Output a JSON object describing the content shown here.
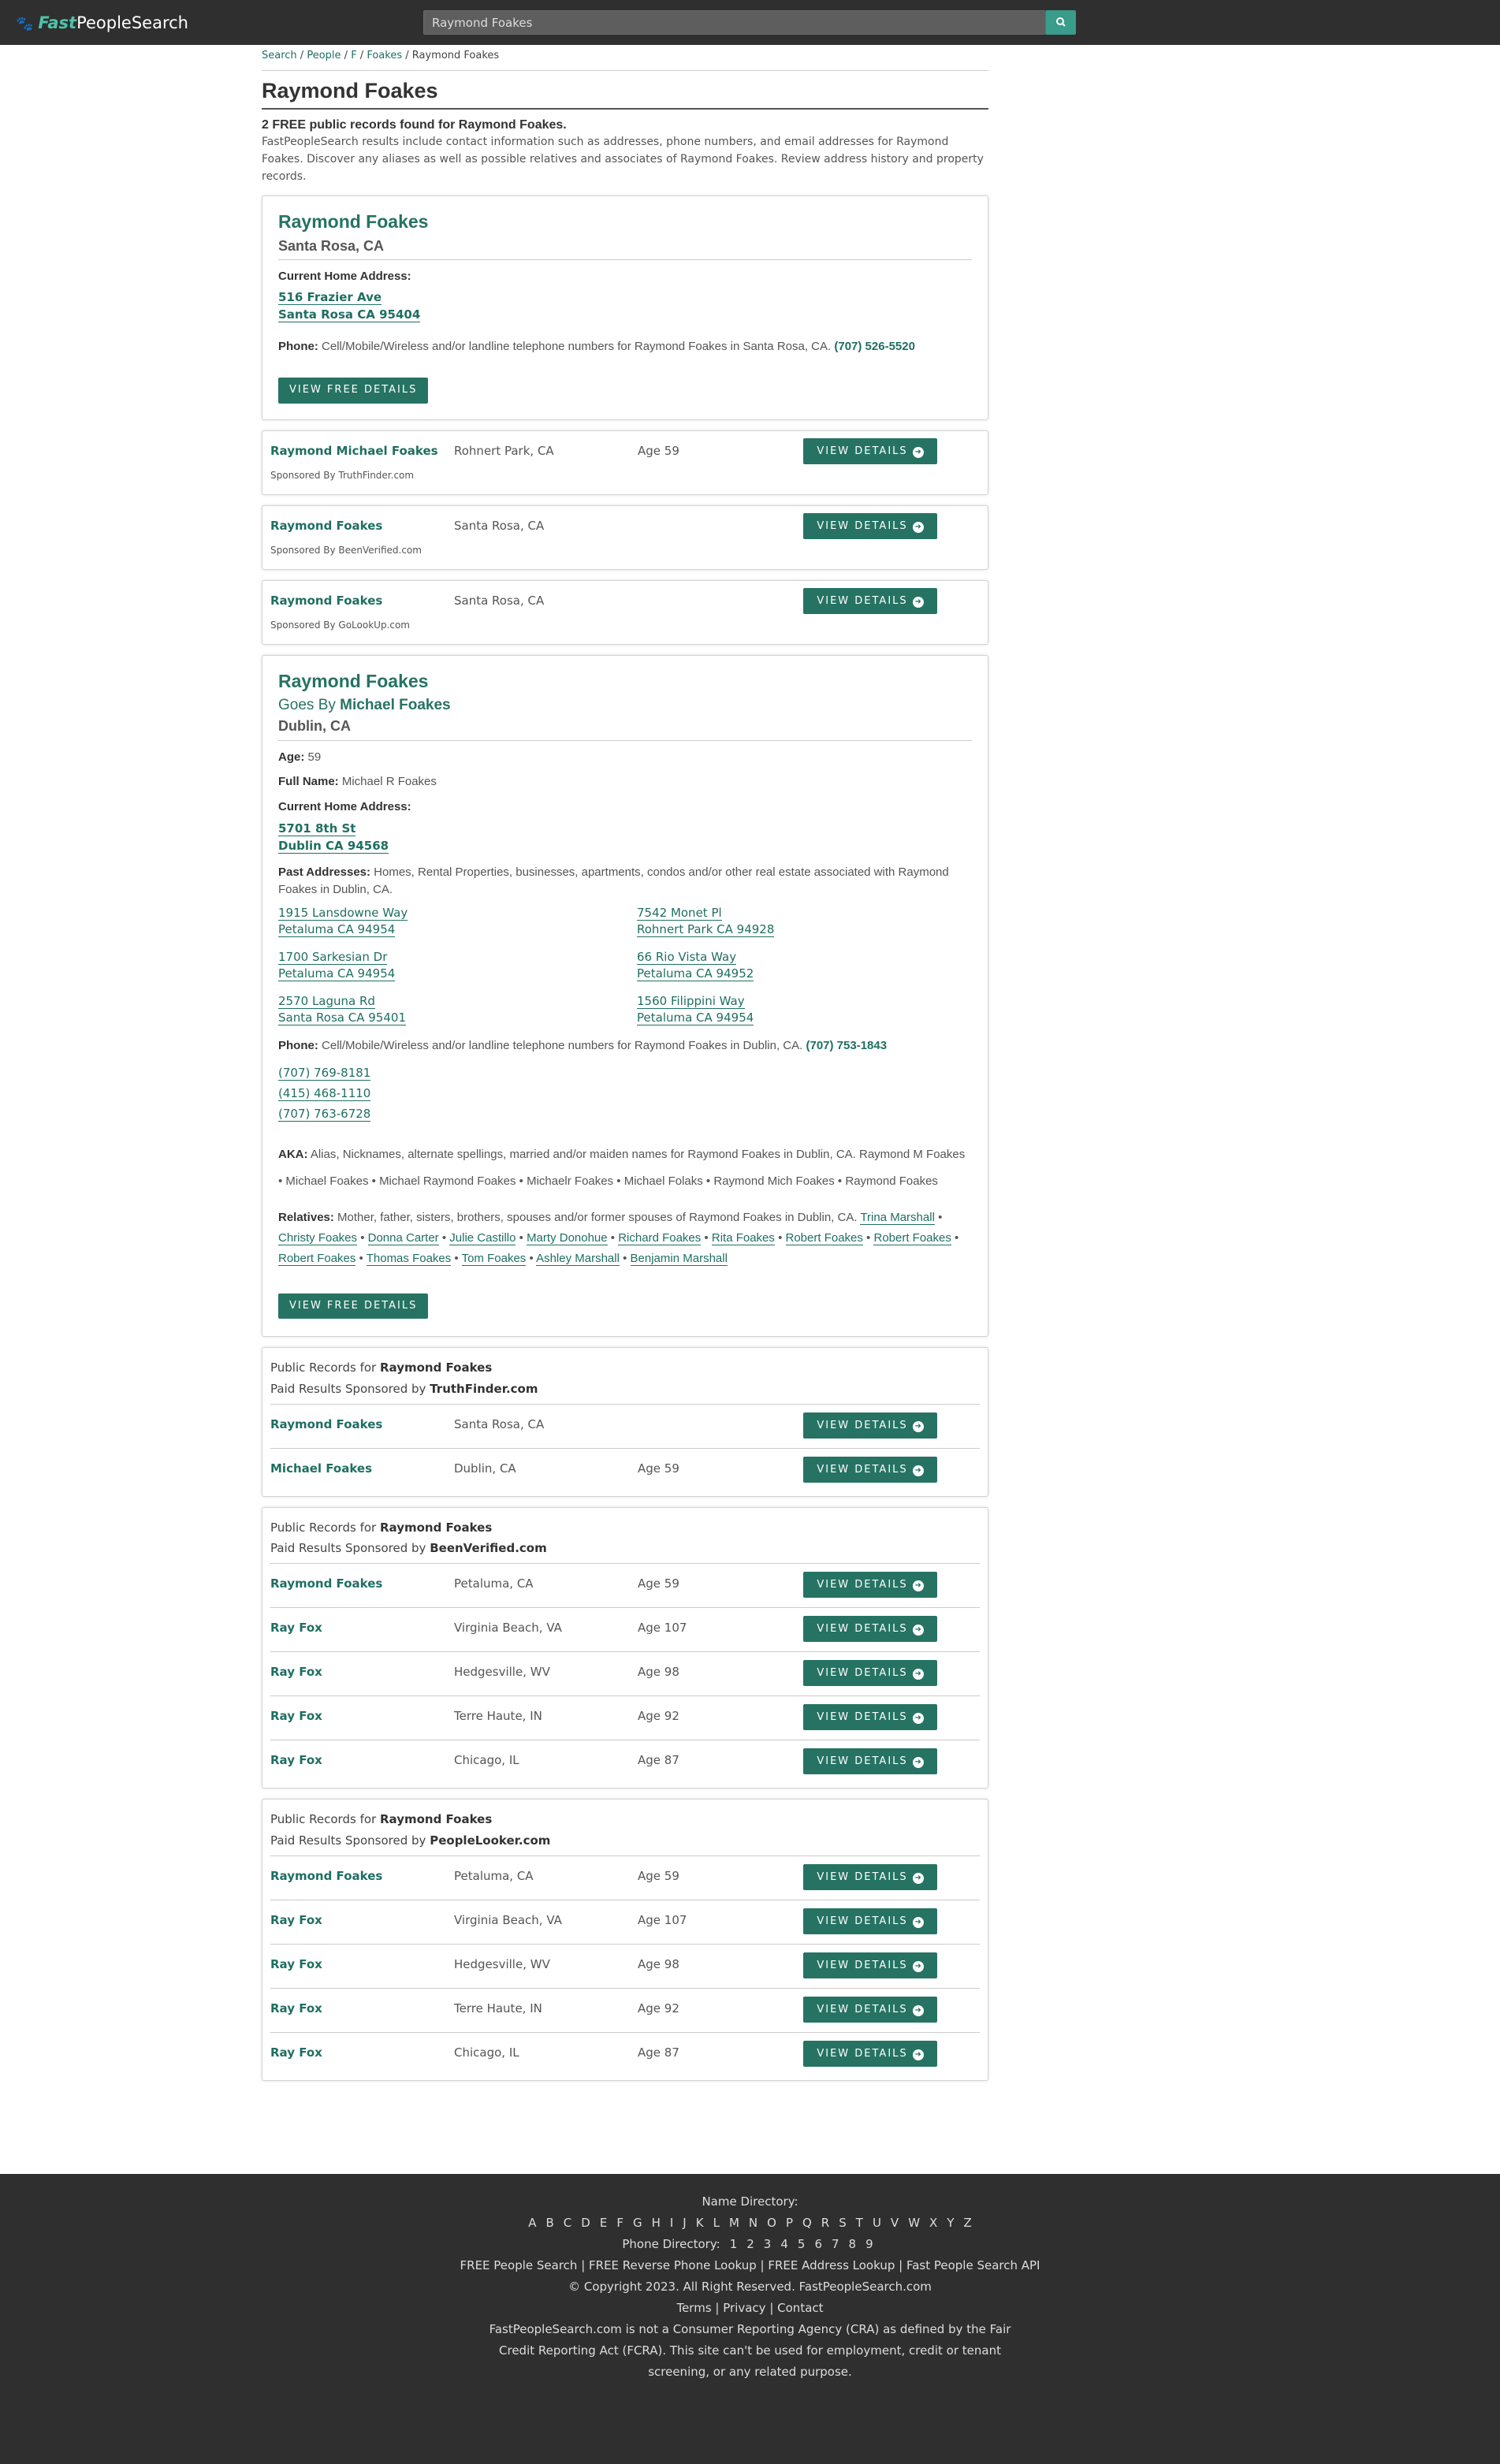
{
  "header": {
    "logo_fast": "Fast",
    "logo_rest": "PeopleSearch",
    "search_value": "Raymond Foakes"
  },
  "breadcrumb": {
    "items": [
      "Search",
      "People",
      "F",
      "Foakes"
    ],
    "current": "Raymond Foakes"
  },
  "page_title": "Raymond Foakes",
  "found_text": "2 FREE public records found for Raymond Foakes.",
  "intro": "FastPeopleSearch results include contact information such as addresses, phone numbers, and email addresses for Raymond Foakes. Discover any aliases as well as possible relatives and associates of Raymond Foakes. Review address history and property records.",
  "record1": {
    "name": "Raymond Foakes",
    "city": "Santa Rosa, CA",
    "addr_label": "Current Home Address:",
    "addr_line1": "516 Frazier Ave",
    "addr_line2": "Santa Rosa CA 95404",
    "phone_label": "Phone:",
    "phone_desc": "Cell/Mobile/Wireless and/or landline telephone numbers for Raymond Foakes in Santa Rosa, CA.",
    "phone": "(707) 526-5520",
    "button": "VIEW FREE DETAILS"
  },
  "sponsored": [
    {
      "name": "Raymond Michael Foakes",
      "loc": "Rohnert Park, CA",
      "age": "Age 59",
      "sponsor": "Sponsored By TruthFinder.com",
      "button": "VIEW DETAILS"
    },
    {
      "name": "Raymond Foakes",
      "loc": "Santa Rosa, CA",
      "age": "",
      "sponsor": "Sponsored By BeenVerified.com",
      "button": "VIEW DETAILS"
    },
    {
      "name": "Raymond Foakes",
      "loc": "Santa Rosa, CA",
      "age": "",
      "sponsor": "Sponsored By GoLookUp.com",
      "button": "VIEW DETAILS"
    }
  ],
  "record2": {
    "name": "Raymond Foakes",
    "goes_by_prefix": "Goes By",
    "goes_by": "Michael Foakes",
    "city": "Dublin, CA",
    "age_label": "Age:",
    "age": "59",
    "fullname_label": "Full Name:",
    "fullname": "Michael R Foakes",
    "addr_label": "Current Home Address:",
    "addr_line1": "5701 8th St",
    "addr_line2": "Dublin CA 94568",
    "past_label": "Past Addresses:",
    "past_desc": "Homes, Rental Properties, businesses, apartments, condos and/or other real estate associated with Raymond Foakes in Dublin, CA.",
    "past": [
      {
        "l1": "1915 Lansdowne Way",
        "l2": "Petaluma CA 94954"
      },
      {
        "l1": "7542 Monet Pl",
        "l2": "Rohnert Park CA 94928"
      },
      {
        "l1": "1700 Sarkesian Dr",
        "l2": "Petaluma CA 94954"
      },
      {
        "l1": "66 Rio Vista Way",
        "l2": "Petaluma CA 94952"
      },
      {
        "l1": "2570 Laguna Rd",
        "l2": "Santa Rosa CA 95401"
      },
      {
        "l1": "1560 Filippini Way",
        "l2": "Petaluma CA 94954"
      }
    ],
    "phone_label": "Phone:",
    "phone_desc": "Cell/Mobile/Wireless and/or landline telephone numbers for Raymond Foakes in Dublin, CA.",
    "phone": "(707) 753-1843",
    "phones": [
      "(707) 769-8181",
      "(415) 468-1110",
      "(707) 763-6728"
    ],
    "aka_label": "AKA:",
    "aka_desc": "Alias, Nicknames, alternate spellings, married and/or maiden names for Raymond Foakes in Dublin, CA.",
    "aka": [
      "Raymond M Foakes",
      "Michael Foakes",
      "Michael Raymond Foakes",
      "Michaelr Foakes",
      "Michael Folaks",
      "Raymond Mich Foakes",
      "Raymond Foakes"
    ],
    "rel_label": "Relatives:",
    "rel_desc": "Mother, father, sisters, brothers, spouses and/or former spouses of Raymond Foakes in Dublin, CA.",
    "relatives": [
      "Trina Marshall",
      "Christy Foakes",
      "Donna Carter",
      "Julie Castillo",
      "Marty Donohue",
      "Richard Foakes",
      "Rita Foakes",
      "Robert Foakes",
      "Robert Foakes",
      "Robert Foakes",
      "Thomas Foakes",
      "Tom Foakes",
      "Ashley Marshall",
      "Benjamin Marshall"
    ],
    "button": "VIEW FREE DETAILS"
  },
  "sections": [
    {
      "head1": "Public Records for",
      "head_name": "Raymond Foakes",
      "head2": "Paid Results Sponsored by",
      "sponsor": "TruthFinder.com",
      "rows": [
        {
          "name": "Raymond Foakes",
          "loc": "Santa Rosa, CA",
          "age": ""
        },
        {
          "name": "Michael Foakes",
          "loc": "Dublin, CA",
          "age": "Age 59"
        }
      ]
    },
    {
      "head1": "Public Records for",
      "head_name": "Raymond Foakes",
      "head2": "Paid Results Sponsored by",
      "sponsor": "BeenVerified.com",
      "rows": [
        {
          "name": "Raymond Foakes",
          "loc": "Petaluma, CA",
          "age": "Age 59"
        },
        {
          "name": "Ray Fox",
          "loc": "Virginia Beach, VA",
          "age": "Age 107"
        },
        {
          "name": "Ray Fox",
          "loc": "Hedgesville, WV",
          "age": "Age 98"
        },
        {
          "name": "Ray Fox",
          "loc": "Terre Haute, IN",
          "age": "Age 92"
        },
        {
          "name": "Ray Fox",
          "loc": "Chicago, IL",
          "age": "Age 87"
        }
      ]
    },
    {
      "head1": "Public Records for",
      "head_name": "Raymond Foakes",
      "head2": "Paid Results Sponsored by",
      "sponsor": "PeopleLooker.com",
      "rows": [
        {
          "name": "Raymond Foakes",
          "loc": "Petaluma, CA",
          "age": "Age 59"
        },
        {
          "name": "Ray Fox",
          "loc": "Virginia Beach, VA",
          "age": "Age 107"
        },
        {
          "name": "Ray Fox",
          "loc": "Hedgesville, WV",
          "age": "Age 98"
        },
        {
          "name": "Ray Fox",
          "loc": "Terre Haute, IN",
          "age": "Age 92"
        },
        {
          "name": "Ray Fox",
          "loc": "Chicago, IL",
          "age": "Age 87"
        }
      ]
    }
  ],
  "view_details": "VIEW DETAILS",
  "footer": {
    "name_dir_label": "Name Directory:",
    "letters": [
      "A",
      "B",
      "C",
      "D",
      "E",
      "F",
      "G",
      "H",
      "I",
      "J",
      "K",
      "L",
      "M",
      "N",
      "O",
      "P",
      "Q",
      "R",
      "S",
      "T",
      "U",
      "V",
      "W",
      "X",
      "Y",
      "Z"
    ],
    "phone_dir_label": "Phone Directory:",
    "digits": [
      "1",
      "2",
      "3",
      "4",
      "5",
      "6",
      "7",
      "8",
      "9"
    ],
    "links_line": "FREE People Search | FREE Reverse Phone Lookup | FREE Address Lookup | Fast People Search API",
    "copyright": "© Copyright 2023. All Right Reserved. FastPeopleSearch.com",
    "terms": "Terms",
    "privacy": "Privacy",
    "contact": "Contact",
    "disclaimer_a": "FastPeopleSearch.com is not a Consumer Reporting Agency (CRA) as defined by the",
    "fcra": "Fair Credit Reporting Act (FCRA)",
    "disclaimer_b": ". This site can't be used for employment, credit or tenant screening, or any related purpose."
  }
}
